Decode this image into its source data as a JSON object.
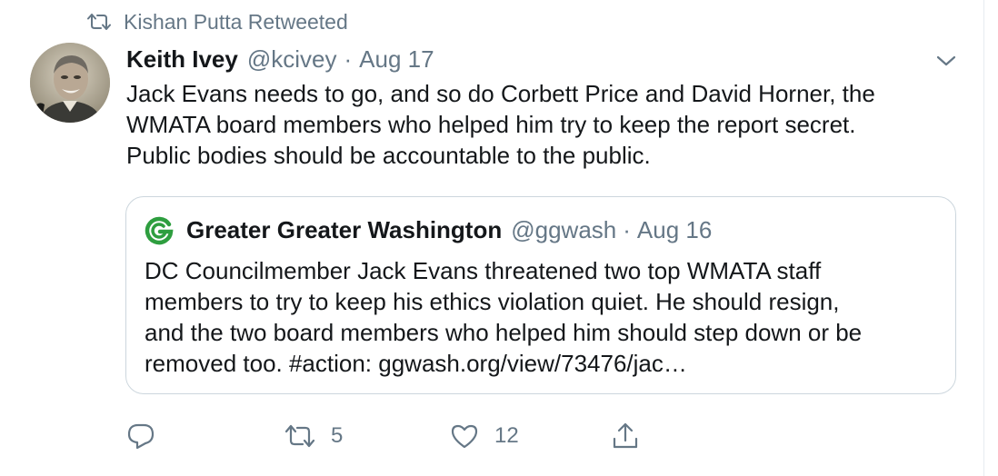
{
  "retweet_context": {
    "icon": "retweet-icon",
    "text": "Kishan Putta Retweeted"
  },
  "tweet": {
    "author_name": "Keith Ivey",
    "author_handle": "@kcivey",
    "separator": "·",
    "date": "Aug 17",
    "text_lines": [
      "Jack Evans needs to go, and so do Corbett Price and David Horner, the",
      "WMATA board members who helped him try to keep the report secret.",
      "Public bodies should be accountable to the public."
    ]
  },
  "quoted_tweet": {
    "author_name": "Greater Greater Washington",
    "author_handle": "@ggwash",
    "separator": "·",
    "date": "Aug 16",
    "logo_color": "#2e9e3f",
    "text_lines": [
      "DC Councilmember Jack Evans threatened two top WMATA staff",
      "members to try to keep his ethics violation quiet. He should resign,",
      "and the two board members who helped him should step down or be",
      "removed too. #action: ggwash.org/view/73476/jac…"
    ]
  },
  "actions": {
    "reply_icon": "reply-icon",
    "retweet_icon": "retweet-icon",
    "retweet_count": "5",
    "like_icon": "heart-icon",
    "like_count": "12",
    "share_icon": "share-icon"
  },
  "colors": {
    "text_primary": "#14171a",
    "text_secondary": "#657786",
    "border": "#ccd6dd"
  }
}
